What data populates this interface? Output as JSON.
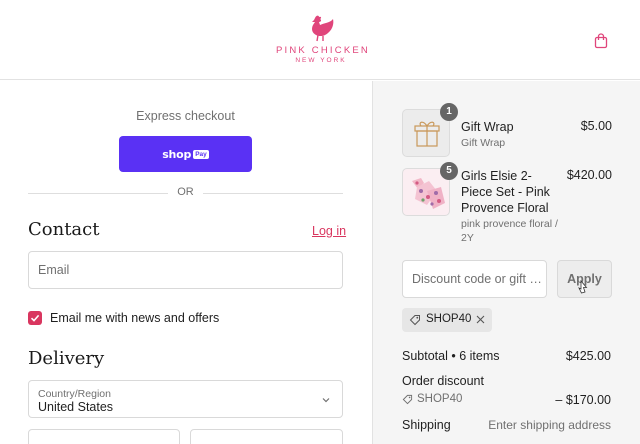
{
  "header": {
    "brand_name": "PINK CHICKEN",
    "brand_sub": "NEW YORK",
    "brand_color": "#e0457b",
    "cart_icon": "shopping-bag-icon"
  },
  "express": {
    "title": "Express checkout",
    "shop_pay_word": "shop",
    "shop_pay_badge": "Pay",
    "shop_pay_color": "#5a31f4",
    "divider_text": "OR"
  },
  "contact": {
    "title": "Contact",
    "login_label": "Log in",
    "email_placeholder": "Email",
    "newsletter_label": "Email me with news and offers",
    "newsletter_checked": true,
    "accent_color": "#d9365f"
  },
  "delivery": {
    "title": "Delivery",
    "country_label": "Country/Region",
    "country_value": "United States"
  },
  "order": {
    "items": [
      {
        "name": "Gift Wrap",
        "variant": "Gift Wrap",
        "quantity": "1",
        "price": "$5.00",
        "thumb_icon": "gift-box-icon"
      },
      {
        "name": "Girls Elsie 2-Piece Set - Pink Provence Floral",
        "variant": "pink provence floral / 2Y",
        "quantity": "5",
        "price": "$420.00",
        "thumb_icon": "floral-outfit-image"
      }
    ],
    "discount_placeholder": "Discount code or gift …",
    "apply_label": "Apply",
    "applied_code": "SHOP40",
    "subtotal_label": "Subtotal • 6 items",
    "subtotal_value": "$425.00",
    "order_discount_label": "Order discount",
    "order_discount_code": "SHOP40",
    "order_discount_value": "– $170.00",
    "shipping_label": "Shipping",
    "shipping_value": "Enter shipping address"
  }
}
